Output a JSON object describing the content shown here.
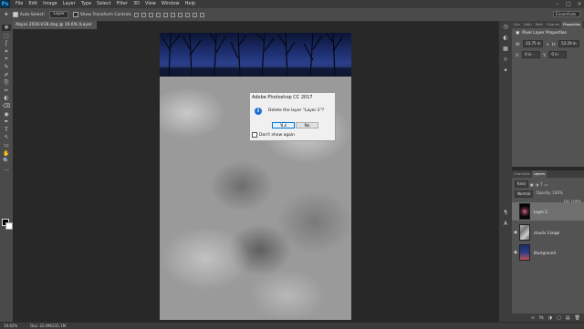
{
  "app": {
    "logo": "Ps"
  },
  "menu": [
    "File",
    "Edit",
    "Image",
    "Layer",
    "Type",
    "Select",
    "Filter",
    "3D",
    "View",
    "Window",
    "Help"
  ],
  "window_controls": [
    "–",
    "□",
    "×"
  ],
  "options_bar": {
    "auto_select_label": "Auto-Select:",
    "auto_select_value": "Layer",
    "show_transform_label": "Show Transform Controls",
    "workspace": "Essentials"
  },
  "document_tab": {
    "title": "Abyss 2016-V18.dng @ 19.6% (Layer 2, RGB/8*) *",
    "close": "×"
  },
  "tools": [
    "✥",
    "⬚",
    "ʃ",
    "⌗",
    "⌖",
    "✎",
    "✐",
    "⎘",
    "✂",
    "◐",
    "⌫",
    "◉",
    "✒",
    "T",
    "↖",
    "▭",
    "✋",
    "🔍",
    "…"
  ],
  "dialog": {
    "title": "Adobe Photoshop CC 2017",
    "message": "Delete the layer \"Layer 2\"?",
    "yes": "Yes",
    "no": "No",
    "dont_show": "Don't show again",
    "icon": "i"
  },
  "strip_icons": [
    "history-icon",
    "color-icon",
    "swatches-icon",
    "adjustments-icon",
    "styles-icon",
    "paragraph-icon",
    "character-icon"
  ],
  "properties": {
    "tabs": [
      "Libr",
      "Adju",
      "Path",
      "Channs",
      "Properties"
    ],
    "heading": "Pixel Layer Properties",
    "w_label": "W:",
    "w_value": "33.75 in",
    "h_label": "H:",
    "h_value": "52.29 in",
    "x_label": "X:",
    "x_value": "0 in",
    "y_label": "Y:",
    "y_value": "0 in"
  },
  "layers": {
    "tabs": [
      "Channels",
      "Layers"
    ],
    "kind": "Kind",
    "blend": "Normal",
    "opacity": "Opacity: 100%",
    "fill": "Fill: 100%",
    "items": [
      {
        "name": "Layer 2",
        "selected": true
      },
      {
        "name": "clouds 3 large",
        "selected": false
      },
      {
        "name": "Background",
        "selected": false
      }
    ],
    "footer_icons": [
      "∞",
      "fx",
      "◑",
      "▢",
      "▤",
      "🗑"
    ]
  },
  "status": {
    "zoom": "19.62%",
    "doc": "Doc: 22.0M/231.1M"
  }
}
